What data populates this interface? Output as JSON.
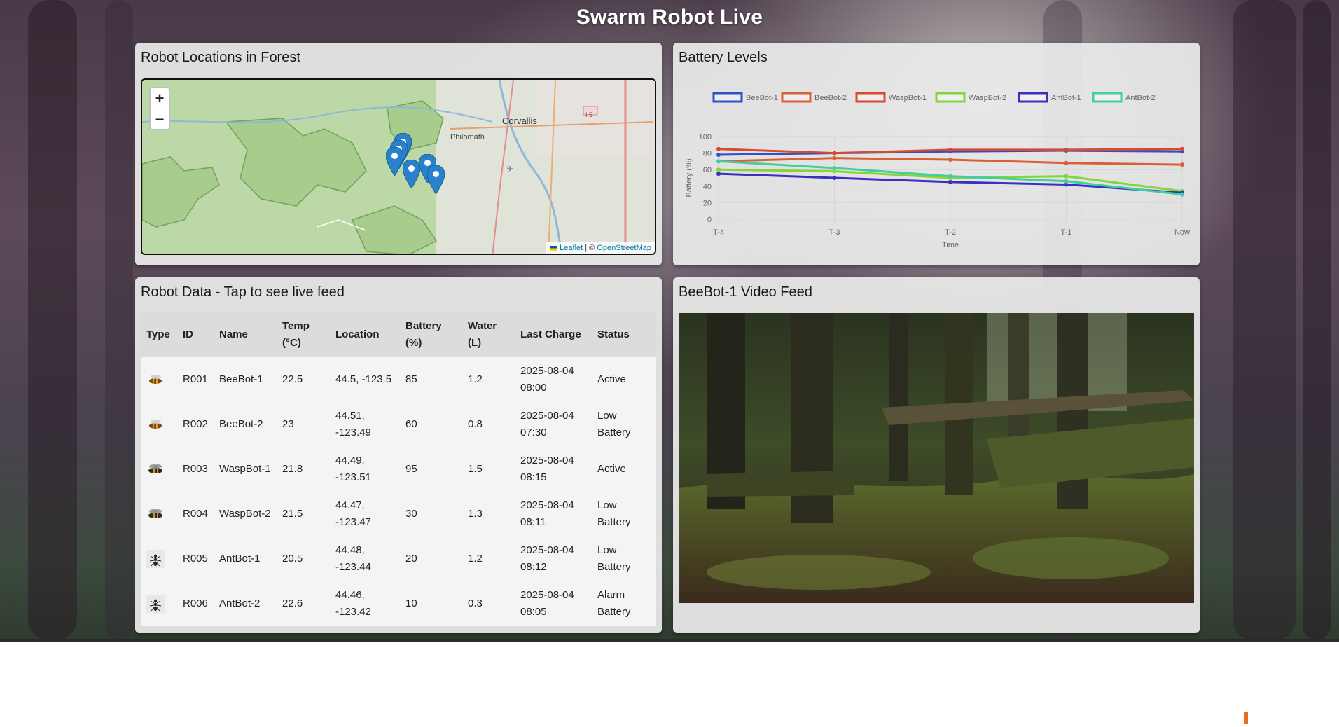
{
  "app": {
    "title": "Swarm Robot Live"
  },
  "map_panel": {
    "title": "Robot Locations in Forest",
    "zoom_in": "+",
    "zoom_out": "−",
    "labels": {
      "city": "Corvallis",
      "town": "Philomath",
      "highway": "I 5"
    },
    "attribution": {
      "leaflet": "Leaflet",
      "separator": " | © ",
      "osm": "OpenStreetMap"
    },
    "marker_icon": "map-marker-icon"
  },
  "battery_panel": {
    "title": "Battery Levels",
    "chart_data": {
      "type": "line",
      "categories": [
        "T-4",
        "T-3",
        "T-2",
        "T-1",
        "Now"
      ],
      "series": [
        {
          "name": "BeeBot-1",
          "color": "#3050c8",
          "values": [
            78,
            80,
            82,
            83,
            82
          ]
        },
        {
          "name": "BeeBot-2",
          "color": "#d86038",
          "values": [
            70,
            74,
            72,
            68,
            66
          ]
        },
        {
          "name": "WaspBot-1",
          "color": "#d84a30",
          "values": [
            85,
            80,
            84,
            84,
            85
          ]
        },
        {
          "name": "WaspBot-2",
          "color": "#86d43c",
          "values": [
            60,
            58,
            50,
            52,
            34
          ]
        },
        {
          "name": "AntBot-1",
          "color": "#3a30c0",
          "values": [
            55,
            50,
            45,
            42,
            32
          ]
        },
        {
          "name": "AntBot-2",
          "color": "#40d0a0",
          "values": [
            70,
            62,
            52,
            46,
            30
          ]
        }
      ],
      "xlabel": "Time",
      "ylabel": "Battery (%)",
      "ylim": [
        0,
        100
      ],
      "yticks": [
        "0",
        "20",
        "40",
        "60",
        "80",
        "100"
      ],
      "legend": "top",
      "grid": true
    }
  },
  "table_panel": {
    "title": "Robot Data - Tap to see live feed",
    "columns": [
      "Type",
      "ID",
      "Name",
      "Temp (°C)",
      "Location",
      "Battery (%)",
      "Water (L)",
      "Last Charge",
      "Status"
    ],
    "rows": [
      {
        "type": "bee-icon",
        "id": "R001",
        "name": "BeeBot-1",
        "temp": "22.5",
        "location": "44.5, -123.5",
        "battery": "85",
        "water": "1.2",
        "last_charge": "2025-08-04 08:00",
        "status": "Active"
      },
      {
        "type": "bee-icon",
        "id": "R002",
        "name": "BeeBot-2",
        "temp": "23",
        "location": "44.51, -123.49",
        "battery": "60",
        "water": "0.8",
        "last_charge": "2025-08-04 07:30",
        "status": "Low Battery"
      },
      {
        "type": "wasp-icon",
        "id": "R003",
        "name": "WaspBot-1",
        "temp": "21.8",
        "location": "44.49, -123.51",
        "battery": "95",
        "water": "1.5",
        "last_charge": "2025-08-04 08:15",
        "status": "Active"
      },
      {
        "type": "wasp-icon",
        "id": "R004",
        "name": "WaspBot-2",
        "temp": "21.5",
        "location": "44.47, -123.47",
        "battery": "30",
        "water": "1.3",
        "last_charge": "2025-08-04 08:11",
        "status": "Low Battery"
      },
      {
        "type": "ant-icon",
        "id": "R005",
        "name": "AntBot-1",
        "temp": "20.5",
        "location": "44.48, -123.44",
        "battery": "20",
        "water": "1.2",
        "last_charge": "2025-08-04 08:12",
        "status": "Low Battery"
      },
      {
        "type": "ant-icon",
        "id": "R006",
        "name": "AntBot-2",
        "temp": "22.6",
        "location": "44.46, -123.42",
        "battery": "10",
        "water": "0.3",
        "last_charge": "2025-08-04 08:05",
        "status": "Alarm Battery"
      }
    ]
  },
  "video_panel": {
    "title": "BeeBot-1 Video Feed"
  },
  "colors": {
    "accent": "#e8701a",
    "marker": "#2a81cb"
  }
}
